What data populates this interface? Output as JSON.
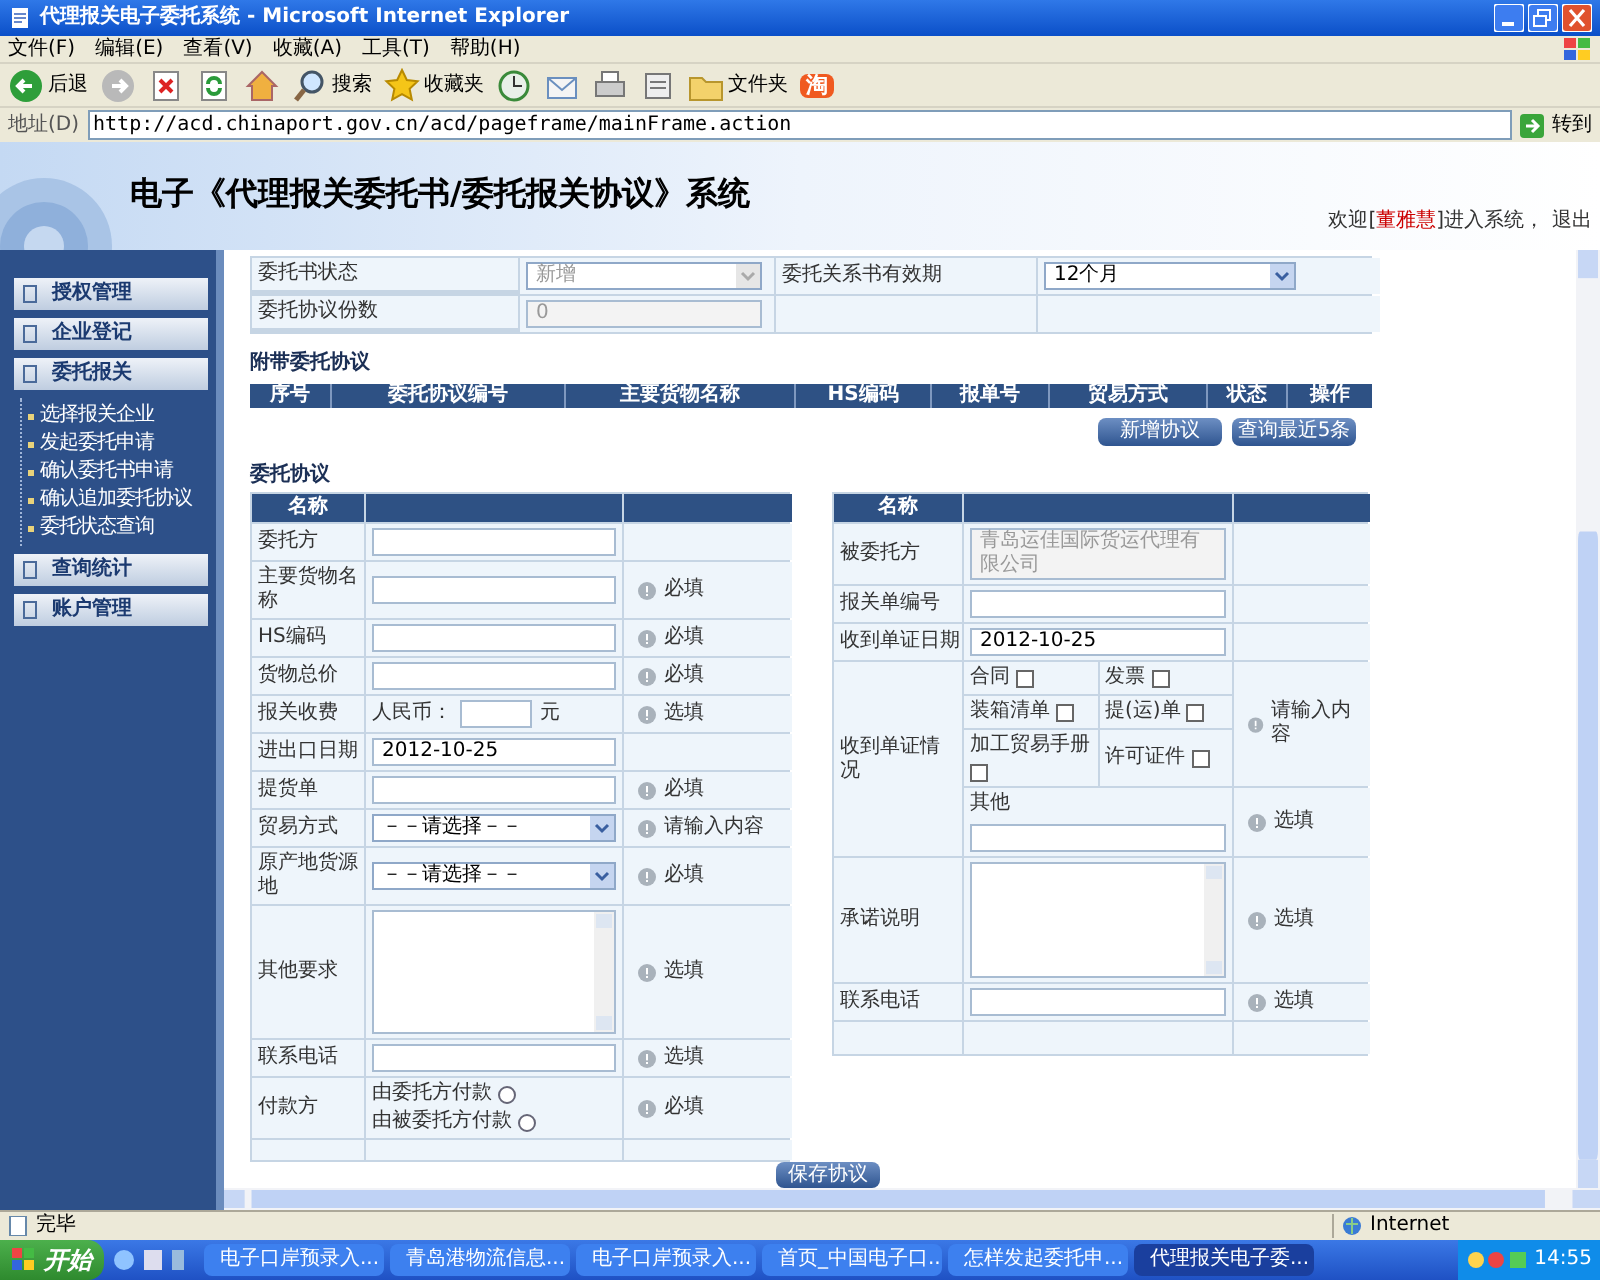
{
  "browser": {
    "title": "代理报关电子委托系统 - Microsoft Internet Explorer",
    "menu": [
      "文件(F)",
      "编辑(E)",
      "查看(V)",
      "收藏(A)",
      "工具(T)",
      "帮助(H)"
    ],
    "toolbar": [
      {
        "kind": "back",
        "label": "后退"
      },
      {
        "kind": "forward"
      },
      {
        "kind": "stop"
      },
      {
        "kind": "refresh"
      },
      {
        "kind": "home"
      },
      {
        "kind": "search",
        "label": "搜索"
      },
      {
        "kind": "favorites",
        "label": "收藏夹"
      },
      {
        "kind": "history"
      },
      {
        "kind": "mail"
      },
      {
        "kind": "print"
      },
      {
        "kind": "edit"
      },
      {
        "kind": "folders",
        "label": "文件夹"
      },
      {
        "kind": "taobao",
        "label": "淘"
      }
    ],
    "address": {
      "label": "地址(D)",
      "url": "http://acd.chinaport.gov.cn/acd/pageframe/mainFrame.action",
      "go": "转到"
    }
  },
  "header": {
    "title": "电子《代理报关委托书/委托报关协议》系统",
    "welcome_prefix": "欢迎[",
    "user": "董雅慧",
    "welcome_suffix": "]进入系统，",
    "logout": "退出"
  },
  "sidebar": [
    {
      "label": "授权管理"
    },
    {
      "label": "企业登记"
    },
    {
      "label": "委托报关",
      "children": [
        "选择报关企业",
        "发起委托申请",
        "确认委托书申请",
        "确认追加委托协议",
        "委托状态查询"
      ]
    },
    {
      "label": "查询统计"
    },
    {
      "label": "账户管理"
    }
  ],
  "top_form": [
    {
      "label": "委托书状态",
      "value": "新增",
      "kind": "select",
      "disabled": true,
      "label_2": "委托关系书有效期",
      "value_2": "12个月"
    },
    {
      "label": "委托协议份数",
      "value": "0",
      "kind": "text",
      "disabled": true
    }
  ],
  "attached": {
    "title": "附带委托协议",
    "columns": [
      "序号",
      "委托协议编号",
      "主要货物名称",
      "HS编码",
      "报单号",
      "贸易方式",
      "状态",
      "操作"
    ],
    "buttons": [
      "新增协议",
      "查询最近5条"
    ]
  },
  "agreement": {
    "title": "委托协议",
    "header": "名称",
    "right_header": "名称",
    "left_rows": [
      {
        "label": "委托方",
        "kind": "text"
      },
      {
        "label": "主要货物名称",
        "kind": "text",
        "hint": "必填"
      },
      {
        "label": "HS编码",
        "kind": "text",
        "hint": "必填"
      },
      {
        "label": "货物总价",
        "kind": "text",
        "hint": "必填"
      },
      {
        "label": "报关收费",
        "kind": "fee",
        "prefix": "人民币：",
        "suffix": "元",
        "hint": "选填"
      },
      {
        "label": "进出口日期",
        "kind": "text",
        "value": "2012-10-25"
      },
      {
        "label": "提货单",
        "kind": "text",
        "hint": "必填"
      },
      {
        "label": "贸易方式",
        "kind": "select",
        "value": "－－请选择－－",
        "hint": "请输入内容"
      },
      {
        "label": "原产地货源地",
        "kind": "select",
        "value": "－－请选择－－",
        "hint": "必填"
      },
      {
        "label": "其他要求",
        "kind": "textarea",
        "hint": "选填"
      },
      {
        "label": "联系电话",
        "kind": "text",
        "hint": "选填"
      },
      {
        "label": "付款方",
        "kind": "radio",
        "options": [
          {
            "label": "由委托方付款",
            "selected": false
          },
          {
            "label": "由被委托方付款",
            "selected": false
          }
        ],
        "hint": "必填"
      }
    ],
    "right_rows": [
      {
        "label": "被委托方",
        "kind": "text",
        "value": "青岛运佳国际货运代理有限公司",
        "disabled": true
      },
      {
        "label": "报关单编号",
        "kind": "text"
      },
      {
        "label": "收到单证日期",
        "kind": "text",
        "value": "2012-10-25"
      },
      {
        "label": "收到单证情况",
        "kind": "docs",
        "checks": [
          {
            "label": "合同",
            "checked": false
          },
          {
            "label": "发票",
            "checked": false
          },
          {
            "label": "装箱清单",
            "checked": false
          },
          {
            "label": "提(运)单",
            "checked": false
          },
          {
            "label": "加工贸易手册",
            "checked": false
          },
          {
            "label": "许可证件",
            "checked": false
          }
        ],
        "hint": "请输入内容",
        "other_label": "其他",
        "other_hint": "选填"
      },
      {
        "label": "承诺说明",
        "kind": "textarea",
        "hint": "选填"
      },
      {
        "label": "联系电话",
        "kind": "text",
        "hint": "选填"
      }
    ],
    "save": "保存协议"
  },
  "status_bar": {
    "text": "完毕",
    "zone": "Internet"
  },
  "taskbar": {
    "start": "开始",
    "tasks": [
      {
        "label": "电子口岸预录入...",
        "selected": false
      },
      {
        "label": "青岛港物流信息...",
        "selected": false
      },
      {
        "label": "电子口岸预录入...",
        "selected": false
      },
      {
        "label": "首页_中国电子口...",
        "selected": false
      },
      {
        "label": "怎样发起委托申...",
        "selected": false
      },
      {
        "label": "代理报关电子委...",
        "selected": true
      }
    ],
    "clock": "14:55"
  }
}
